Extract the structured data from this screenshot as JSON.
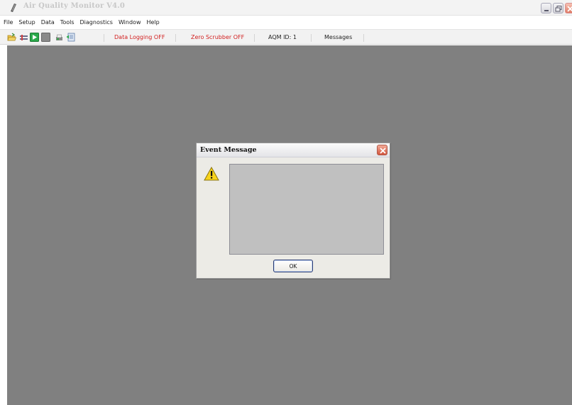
{
  "window": {
    "title": "Air Quality Monitor V4.0",
    "icons": [
      "app-icon",
      "minimize-icon",
      "maximize-icon",
      "close-icon"
    ]
  },
  "menu": {
    "items": [
      {
        "label": "File"
      },
      {
        "label": "Setup"
      },
      {
        "label": "Data"
      },
      {
        "label": "Tools"
      },
      {
        "label": "Diagnostics"
      },
      {
        "label": "Window"
      },
      {
        "label": "Help"
      }
    ]
  },
  "toolbar": {
    "icons": [
      "open-folder-icon",
      "connect-icon",
      "start-icon",
      "stop-icon",
      "print-icon",
      "export-icon"
    ],
    "status": {
      "data_logging": "Data Logging OFF",
      "zero_scrubber": "Zero Scrubber OFF",
      "aqm_id": "AQM ID: 1",
      "messages": "Messages"
    }
  },
  "dialog": {
    "title": "Event Message",
    "message": "",
    "ok_label": "OK",
    "icons": [
      "warning-icon",
      "close-icon"
    ]
  },
  "colors": {
    "workspace": "#808080",
    "status_red": "#d22020",
    "message_box": "#c0c0c0",
    "dialog_bg": "#ecebe6"
  }
}
